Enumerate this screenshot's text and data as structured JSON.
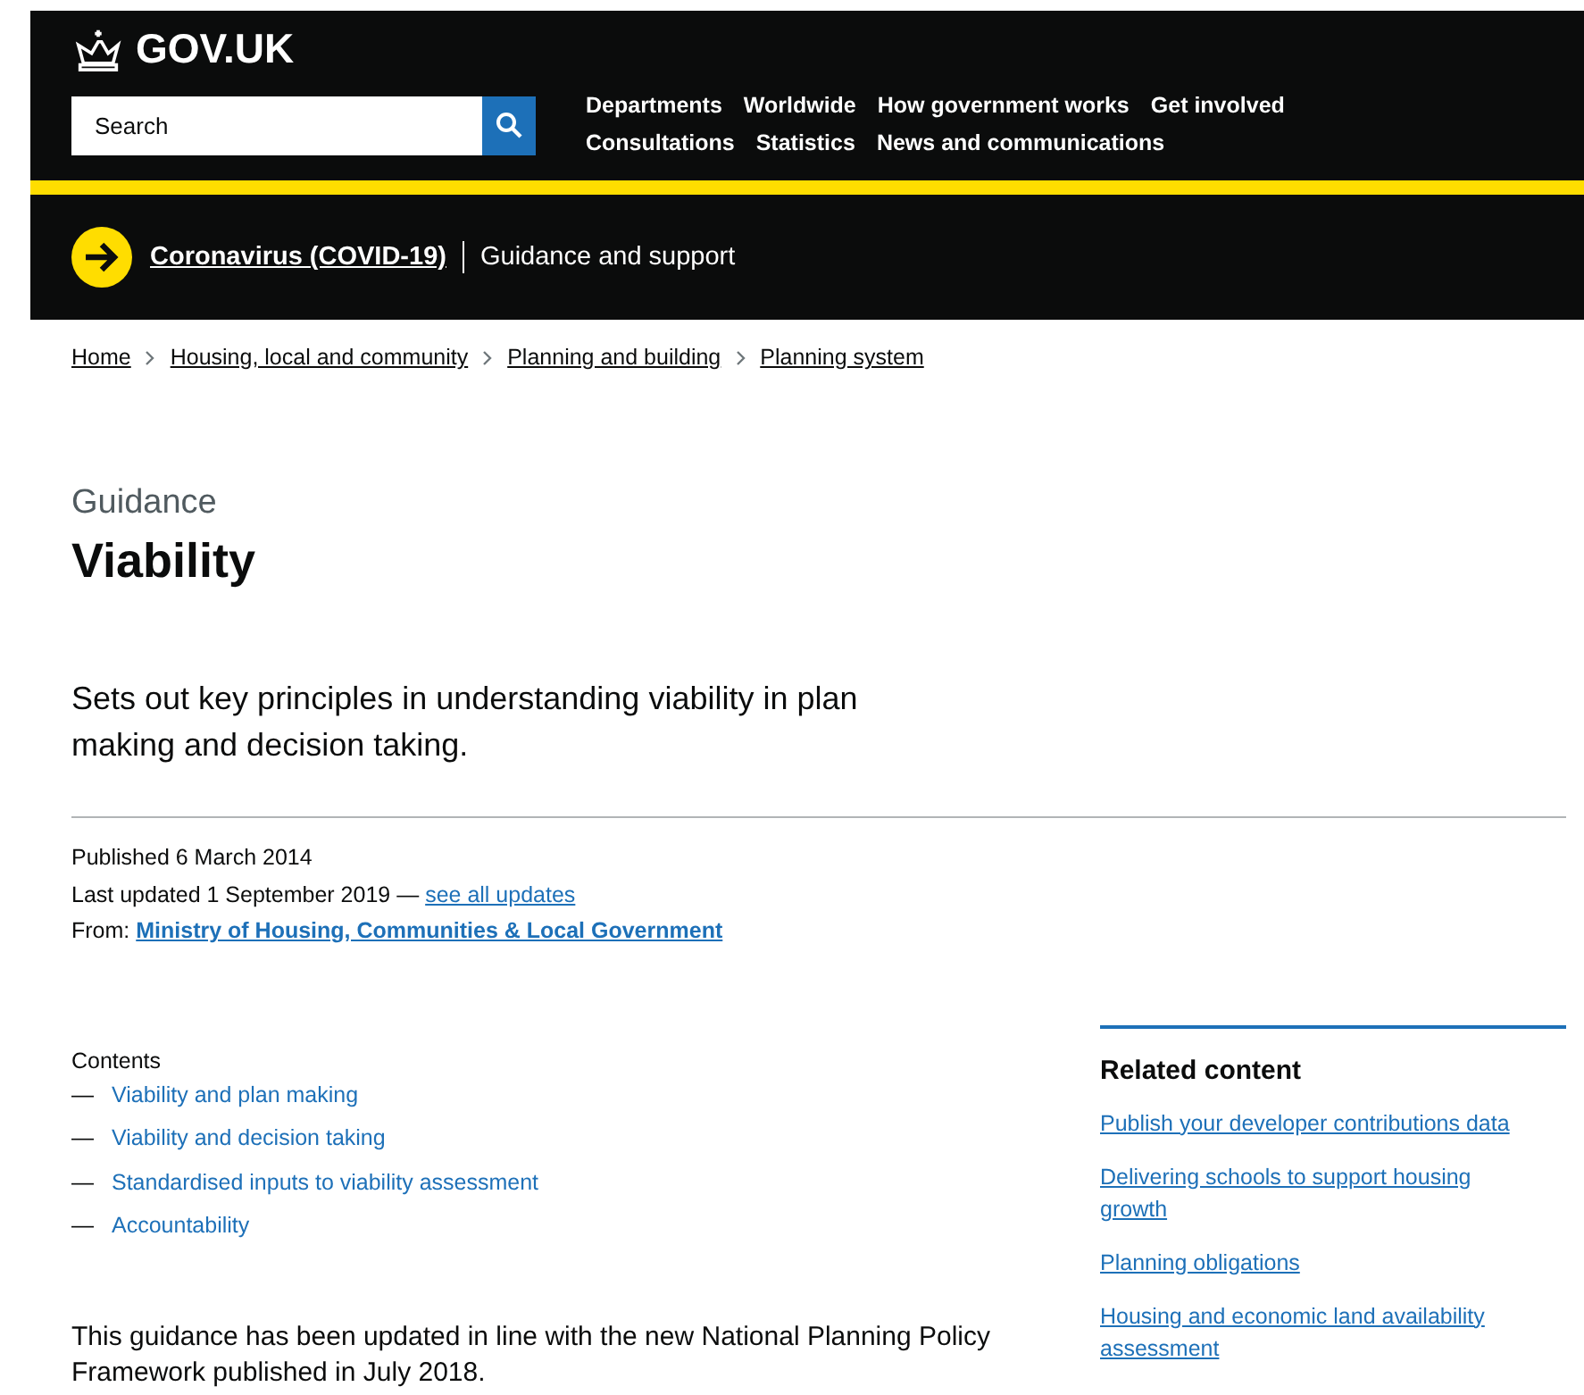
{
  "header": {
    "logo": "GOV.UK",
    "search": {
      "placeholder": "Search"
    },
    "nav": [
      [
        "Departments",
        "Worldwide",
        "How government works",
        "Get involved"
      ],
      [
        "Consultations",
        "Statistics",
        "News and communications"
      ]
    ]
  },
  "banner": {
    "link": "Coronavirus (COVID-19)",
    "text": "Guidance and support"
  },
  "breadcrumbs": [
    "Home",
    "Housing, local and community",
    "Planning and building",
    "Planning system"
  ],
  "kicker": "Guidance",
  "title": "Viability",
  "lead": "Sets out key principles in understanding viability in plan making and decision taking.",
  "metadata": {
    "published": "Published 6 March 2014",
    "updated": "Last updated 1 September 2019 —",
    "updates_link": "see all updates",
    "from_label": "From:",
    "from_link": "Ministry of Housing, Communities & Local Government"
  },
  "contents": {
    "title": "Contents",
    "items": [
      {
        "dash": "—",
        "label": "Viability and plan making"
      },
      {
        "dash": "—",
        "label": "Viability and decision taking"
      },
      {
        "dash": "—",
        "label": "Standardised inputs to viability assessment"
      },
      {
        "dash": "—",
        "label": "Accountability"
      }
    ]
  },
  "body": "This guidance has been updated in line with the new National Planning Policy Framework published in July 2018.",
  "related": {
    "title": "Related content",
    "links": [
      "Publish your developer contributions data",
      "Delivering schools to support housing growth",
      "Planning obligations",
      "Housing and economic land availability assessment"
    ]
  }
}
